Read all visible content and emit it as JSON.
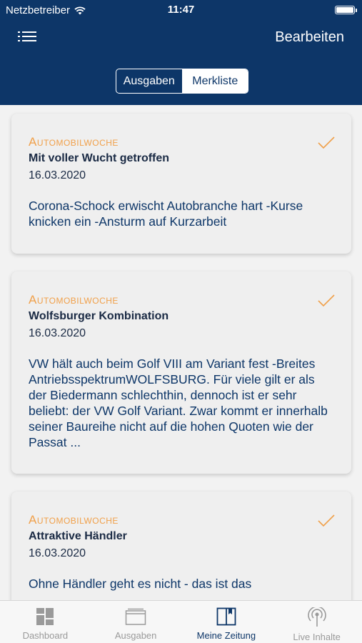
{
  "status_bar": {
    "carrier": "Netzbetreiber",
    "time": "11:47"
  },
  "header": {
    "edit_label": "Bearbeiten"
  },
  "segmented": {
    "left": "Ausgaben",
    "right": "Merkliste"
  },
  "articles": [
    {
      "publisher": "Automobilwoche",
      "title": "Mit voller Wucht getroffen",
      "date": "16.03.2020",
      "body": "Corona-Schock erwischt Autobranche hart -Kurse knicken ein -Ansturm auf Kurzarbeit"
    },
    {
      "publisher": "Automobilwoche",
      "title": "Wolfsburger Kombination",
      "date": "16.03.2020",
      "body": "VW hält auch beim Golf VIII am Variant fest -Breites AntriebsspektrumWOLFSBURG. Für viele gilt er als der Biedermann schlechthin, dennoch ist er sehr beliebt: der VW Golf Variant. Zwar kommt er innerhalb seiner Baureihe nicht auf die hohen Quoten wie der Passat ..."
    },
    {
      "publisher": "Automobilwoche",
      "title": "Attraktive Händler",
      "date": "16.03.2020",
      "body": "Ohne Händler geht es nicht - das ist das"
    }
  ],
  "tabs": [
    {
      "label": "Dashboard",
      "icon": "dashboard-icon"
    },
    {
      "label": "Ausgaben",
      "icon": "issues-icon"
    },
    {
      "label": "Meine Zeitung",
      "icon": "my-newspaper-icon"
    },
    {
      "label": "Live Inhalte",
      "icon": "live-icon"
    }
  ],
  "colors": {
    "header_bg": "#0d3668",
    "publisher": "#f0a04a",
    "active_tab": "#0d3668",
    "inactive_tab": "#9a9a9a"
  }
}
